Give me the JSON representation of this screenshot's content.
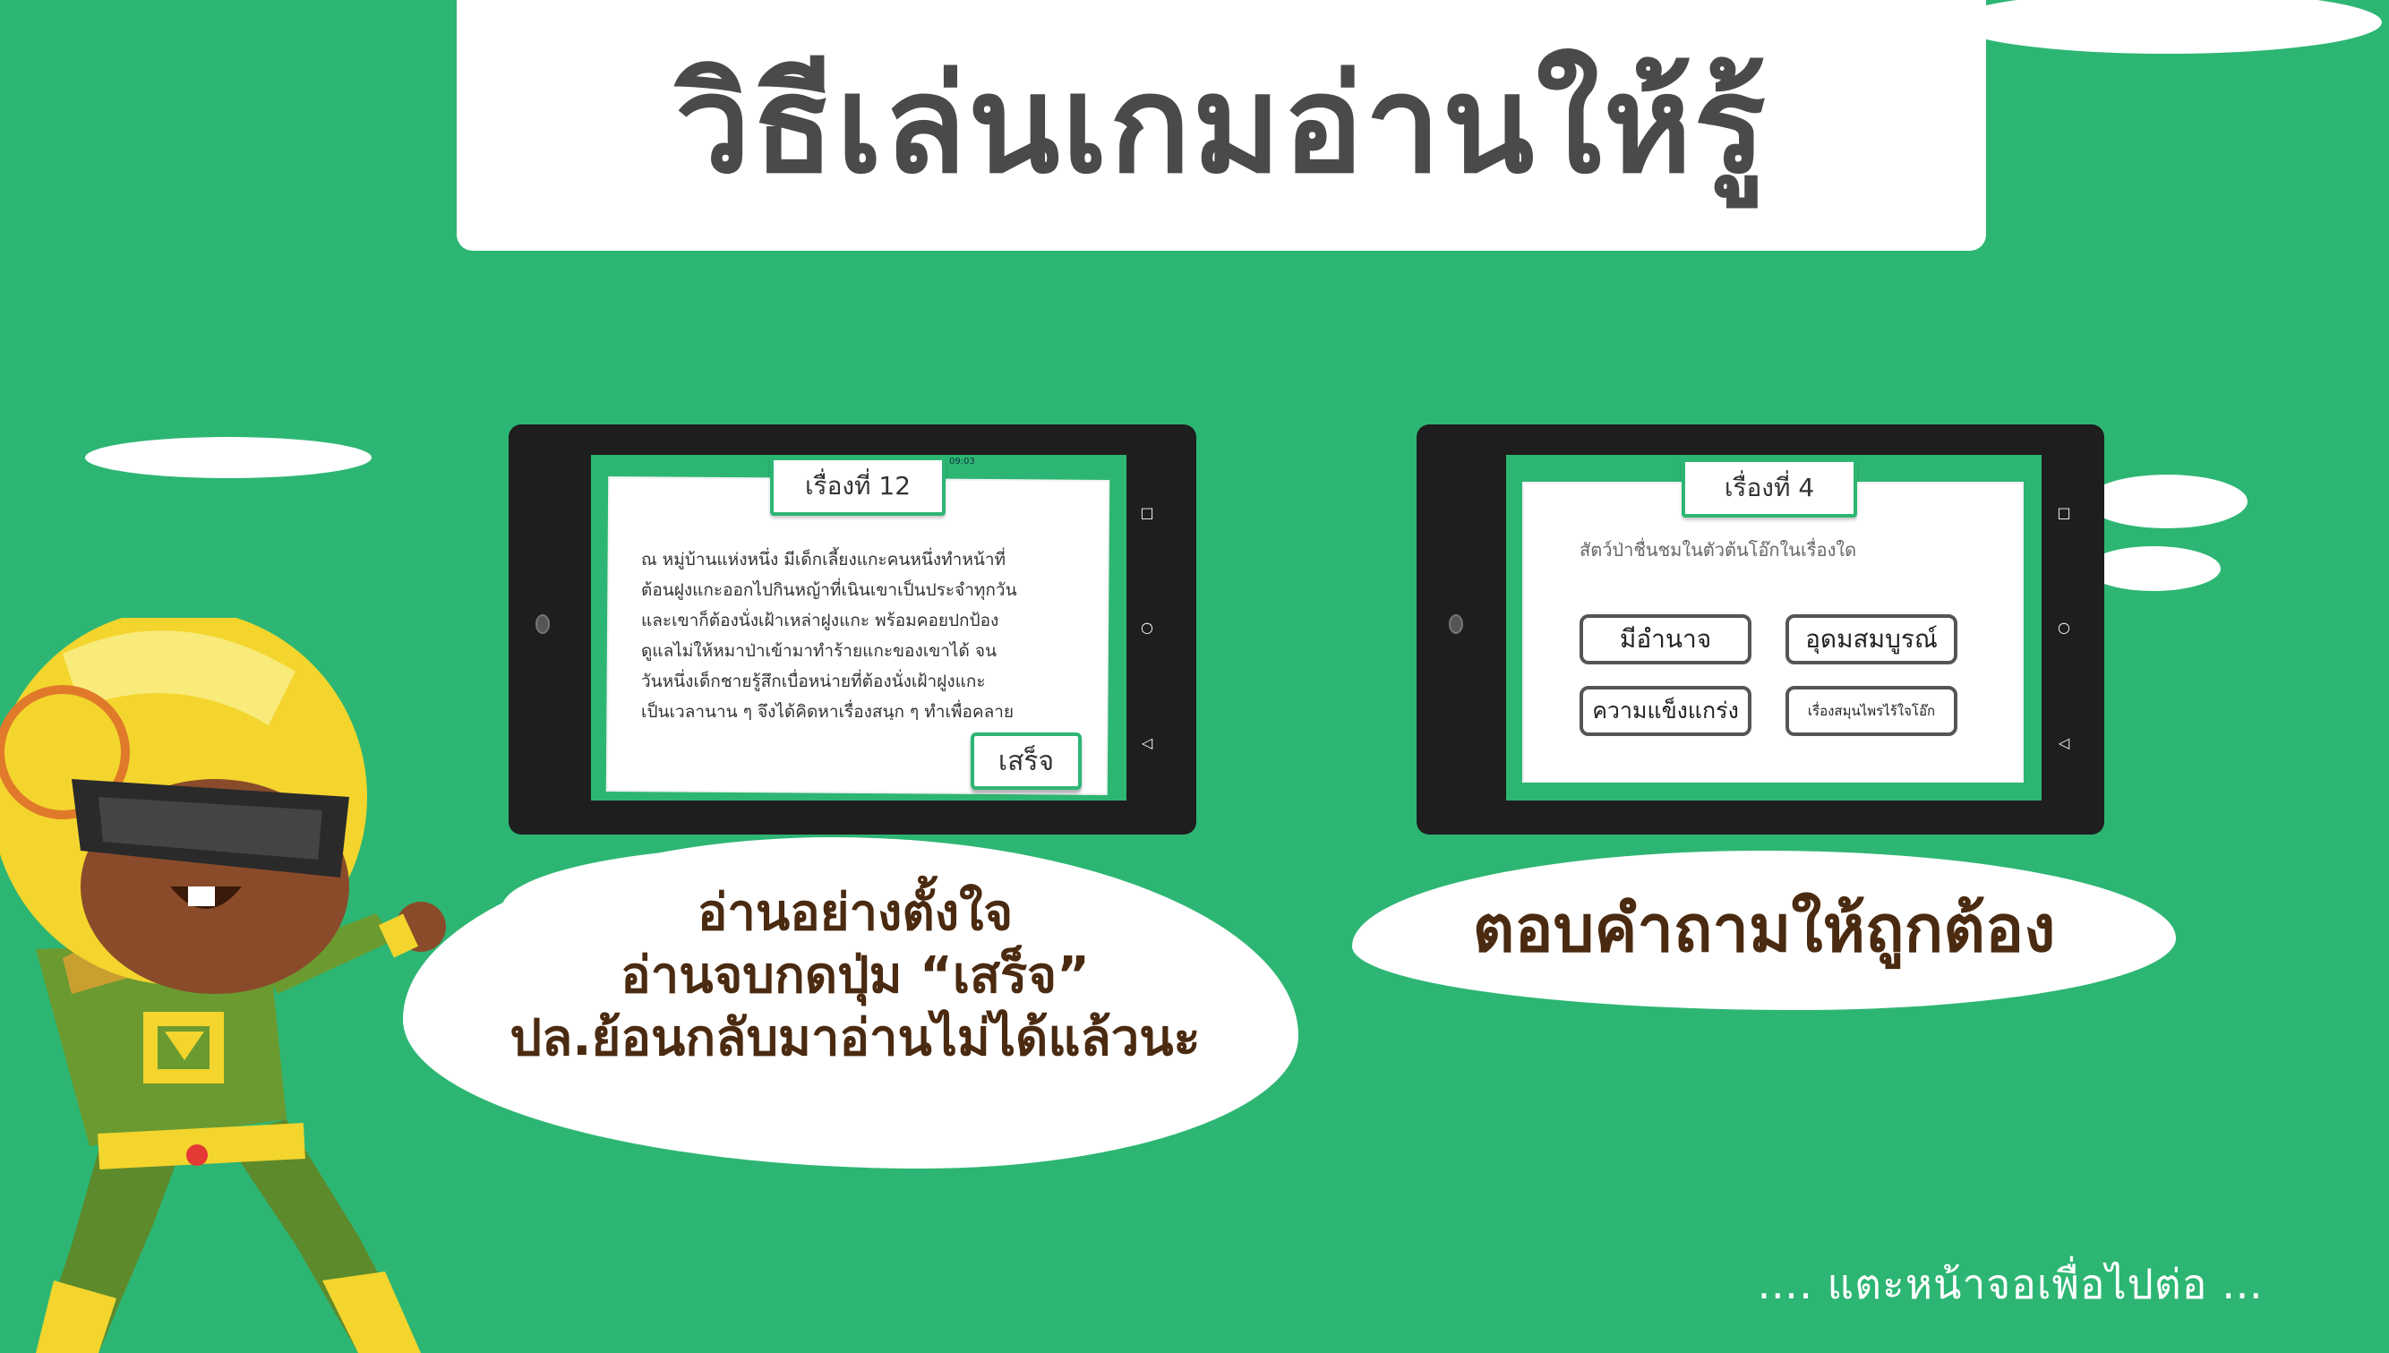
{
  "title": "วิธีเล่นเกมอ่านให้รู้",
  "tablet_left": {
    "timer": "09:03",
    "story_label": "เรื่องที่ 12",
    "story_text": "ณ หมู่บ้านแห่งหนึ่ง มีเด็กเลี้ยงแกะคนหนึ่งทำหน้าที่\nต้อนฝูงแกะออกไปกินหญ้าที่เนินเขาเป็นประจำทุกวัน\nและเขาก็ต้องนั่งเฝ้าเหล่าฝูงแกะ พร้อมคอยปกป้อง\nดูแลไม่ให้หมาป่าเข้ามาทำร้ายแกะของเขาได้ จน\nวันหนึ่งเด็กชายรู้สึกเบื่อหน่ายที่ต้องนั่งเฝ้าฝูงแกะ\nเป็นเวลานาน ๆ จึงได้คิดหาเรื่องสนุก ๆ ทำเพื่อคลาย",
    "finish_button": "เสร็จ"
  },
  "tablet_right": {
    "story_label": "เรื่องที่ 4",
    "question": "สัตว์ป่าชื่นชมในตัวต้นโอ๊กในเรื่องใด",
    "choices": [
      "มีอำนาจ",
      "อุดมสมบูรณ์",
      "ความแข็งแกร่ง",
      "เรื่องสมุนไพรไร้ใจโอ๊ก"
    ]
  },
  "nav_icons": {
    "square": "□",
    "circle": "○",
    "back": "◁"
  },
  "bubble_left": {
    "line1": "อ่านอย่างตั้งใจ",
    "line2": "อ่านจบกดปุ่ม “เสร็จ”",
    "line3": "ปล.ย้อนกลับมาอ่านไม่ได้แล้วนะ"
  },
  "bubble_right": {
    "text": "ตอบคำถามให้ถูกต้อง"
  },
  "footer": "…. แตะหน้าจอเพื่อไปต่อ …",
  "colors": {
    "background": "#2db673",
    "title_text": "#4a4a4a",
    "bubble_text": "#4a2a10",
    "tablet_frame": "#1e1e1e"
  }
}
